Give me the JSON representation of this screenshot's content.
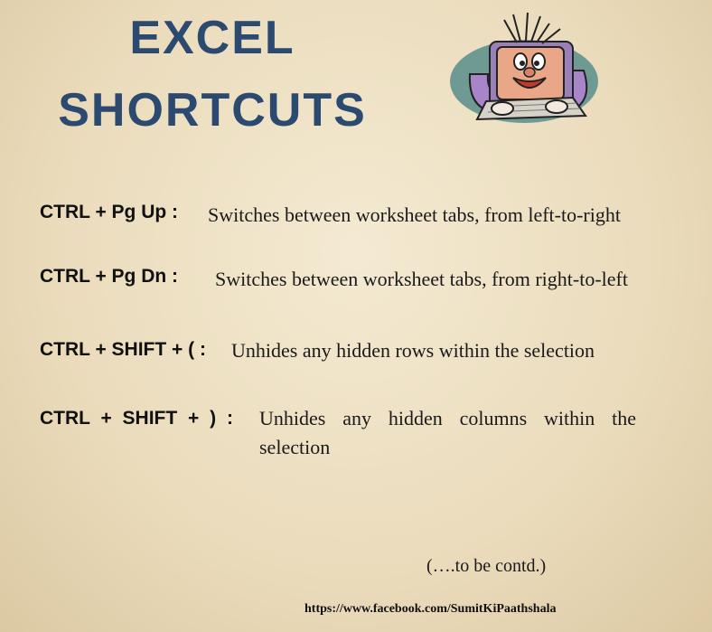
{
  "title": {
    "line1": "EXCEL",
    "line2": "SHORTCUTS"
  },
  "mascot": {
    "icon": "computer-mascot-icon"
  },
  "shortcuts": [
    {
      "key": "CTRL + Pg Up :",
      "description": "Switches between worksheet tabs, from left-to-right"
    },
    {
      "key": "CTRL + Pg Dn :",
      "description": "Switches between worksheet tabs, from right-to-left"
    },
    {
      "key": "CTRL + SHIFT + ( :",
      "description": "Unhides any hidden rows within the selection"
    },
    {
      "key": "CTRL + SHIFT + ) :",
      "description": "Unhides any hidden columns within the selection"
    }
  ],
  "continued": "(….to be contd.)",
  "footer_url": "https://www.facebook.com/SumitKiPaathshala",
  "colors": {
    "title": "#2c4a70",
    "background": "#efe3c6"
  }
}
